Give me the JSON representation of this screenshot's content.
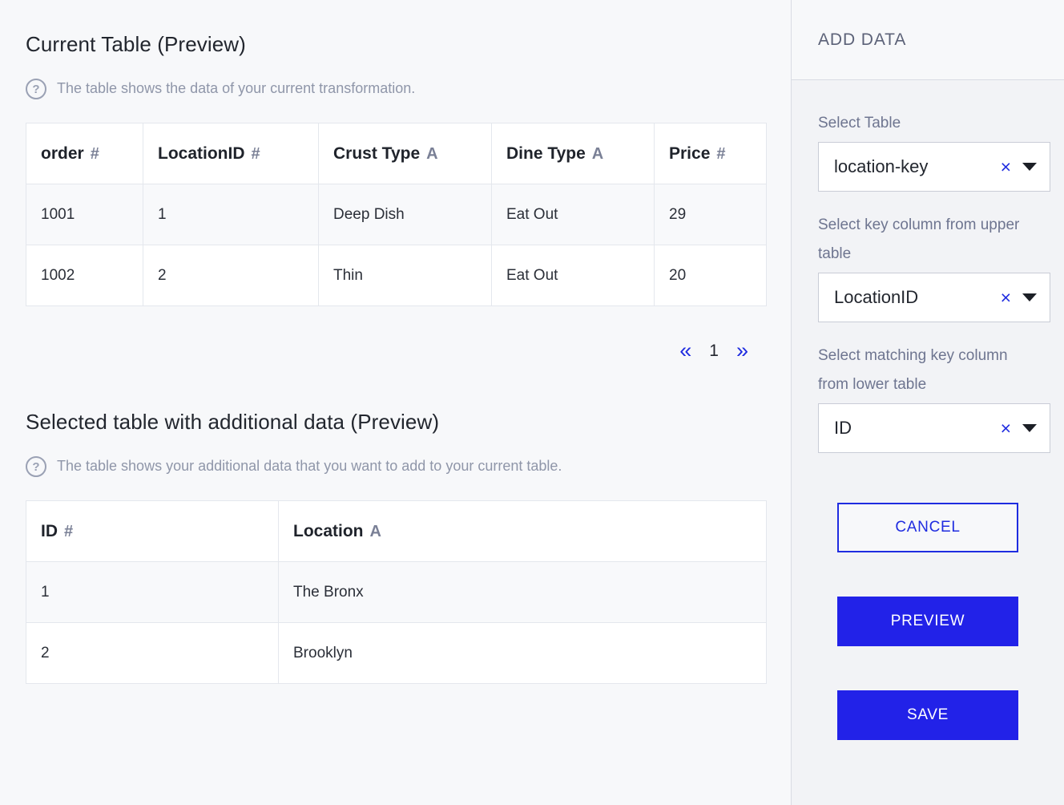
{
  "main": {
    "current_table": {
      "title": "Current Table (Preview)",
      "help_text": "The table shows the data of your current transformation.",
      "help_icon": "question-circle-icon",
      "columns": [
        {
          "label": "order",
          "type": "#"
        },
        {
          "label": "LocationID",
          "type": "#"
        },
        {
          "label": "Crust Type",
          "type": "A"
        },
        {
          "label": "Dine Type",
          "type": "A"
        },
        {
          "label": "Price",
          "type": "#"
        }
      ],
      "rows": [
        [
          "1001",
          "1",
          "Deep Dish",
          "Eat Out",
          "29"
        ],
        [
          "1002",
          "2",
          "Thin",
          "Eat Out",
          "20"
        ]
      ],
      "pagination": {
        "first_icon": "«",
        "page": "1",
        "last_icon": "»"
      }
    },
    "selected_table": {
      "title": "Selected table with additional data (Preview)",
      "help_text": "The table shows your additional data that you want to add to your current table.",
      "help_icon": "question-circle-icon",
      "columns": [
        {
          "label": "ID",
          "type": "#"
        },
        {
          "label": "Location",
          "type": "A"
        }
      ],
      "rows": [
        [
          "1",
          "The Bronx"
        ],
        [
          "2",
          "Brooklyn"
        ]
      ]
    }
  },
  "side_panel": {
    "header_title": "ADD DATA",
    "fields": [
      {
        "label": "Select Table",
        "value": "location-key",
        "clear_icon": "×",
        "caret_icon": "chevron-down-icon"
      },
      {
        "label": "Select key column from upper table",
        "value": "LocationID",
        "clear_icon": "×",
        "caret_icon": "chevron-down-icon"
      },
      {
        "label": "Select matching key column from lower table",
        "value": "ID",
        "clear_icon": "×",
        "caret_icon": "chevron-down-icon"
      }
    ],
    "buttons": {
      "cancel": "CANCEL",
      "preview": "PREVIEW",
      "save": "SAVE"
    }
  },
  "colors": {
    "accent_blue": "#2222e8",
    "link_blue": "#1f2ce0",
    "muted_text": "#8f96a9",
    "panel_bg": "#f2f3f6",
    "page_bg": "#f7f8fa"
  }
}
